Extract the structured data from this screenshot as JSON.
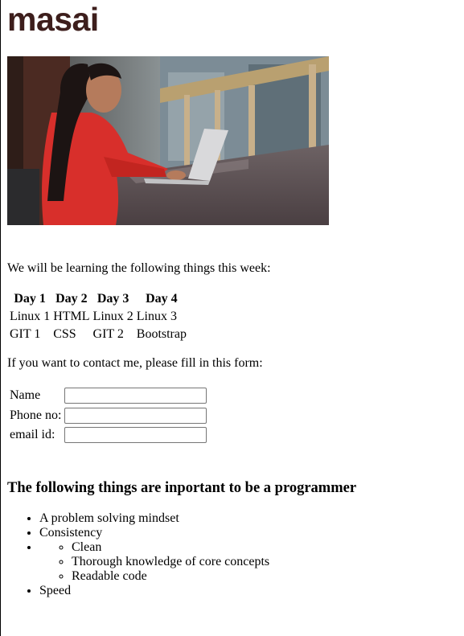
{
  "brand": {
    "logo_text": "masai"
  },
  "hero_image": {
    "alt": "woman in red sweater working on laptop"
  },
  "intro_text": "We will be learning the following things this week:",
  "schedule": {
    "headers": [
      "Day 1",
      "Day 2",
      "Day 3",
      "Day 4"
    ],
    "rows": [
      [
        "Linux 1",
        "HTML",
        "Linux 2",
        "Linux 3"
      ],
      [
        "GIT 1",
        "CSS",
        "GIT 2",
        "Bootstrap"
      ]
    ]
  },
  "contact": {
    "intro": "If you want to contact me, please fill in this form:",
    "fields": [
      {
        "label": "Name",
        "value": "",
        "placeholder": ""
      },
      {
        "label": "Phone no:",
        "value": "",
        "placeholder": ""
      },
      {
        "label": "email id:",
        "value": "",
        "placeholder": ""
      }
    ]
  },
  "programmer": {
    "heading": "The following things are inportant to be a programmer",
    "items": [
      "A problem solving mindset",
      "Consistency",
      "",
      "Speed"
    ],
    "sub_items": [
      "Clean",
      "Thorough knowledge of core concepts",
      "Readable code"
    ]
  }
}
